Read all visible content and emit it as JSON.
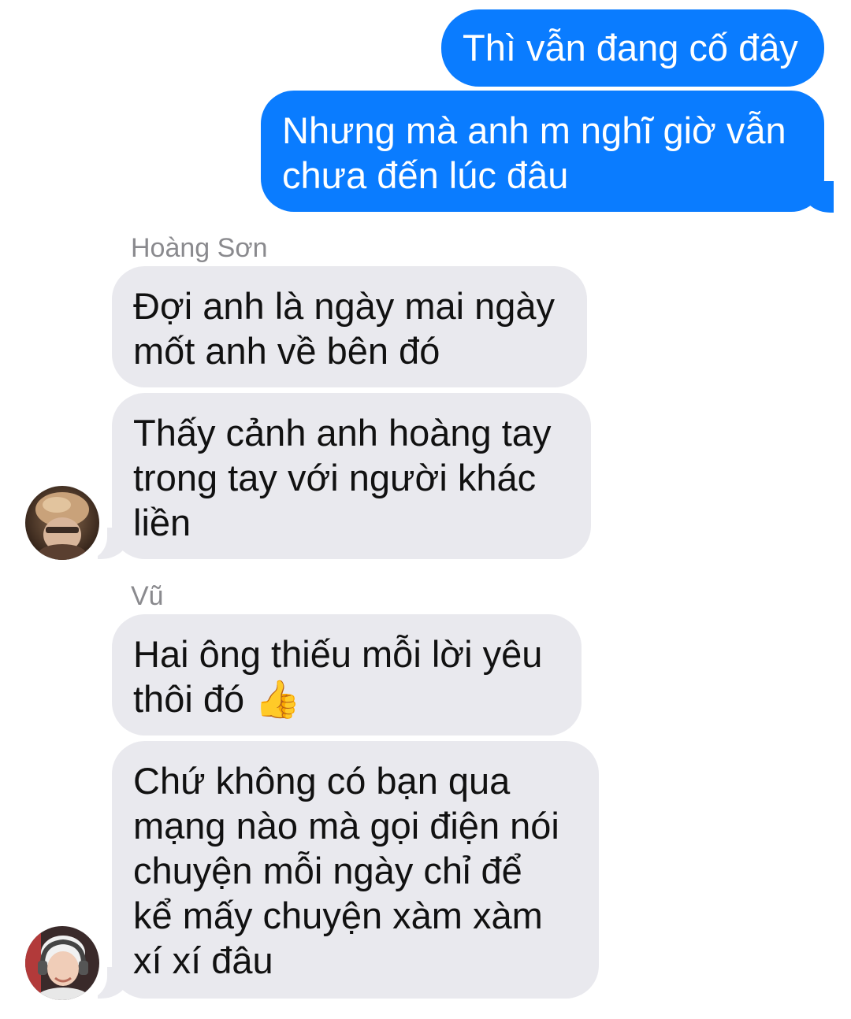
{
  "messages": {
    "outgoing": [
      {
        "lines": [
          "Thì vẫn đang cố đây"
        ]
      },
      {
        "lines": [
          "Nhưng mà anh m nghĩ giờ vẫn",
          "chưa đến lúc đâu"
        ]
      }
    ],
    "groups": [
      {
        "sender": "Hoàng Sơn",
        "avatar_icon": "person-avatar-icon",
        "bubbles": [
          {
            "lines": [
              "Đợi anh là ngày mai ngày",
              "mốt anh về bên đó"
            ]
          },
          {
            "lines": [
              "Thấy cảnh anh hoàng tay",
              "trong tay với người khác",
              "liền"
            ]
          }
        ]
      },
      {
        "sender": "Vũ",
        "avatar_icon": "person-avatar-icon",
        "bubbles": [
          {
            "lines": [
              "Hai ông thiếu mỗi lời yêu",
              "thôi đó"
            ],
            "emoji": "👍"
          },
          {
            "lines": [
              "Chứ không có bạn qua",
              "mạng nào mà gọi điện nói",
              "chuyện mỗi ngày chỉ để",
              "kể mấy chuyện xàm xàm",
              "xí xí đâu"
            ]
          }
        ]
      }
    ]
  },
  "colors": {
    "outgoing_bubble": "#0a7cff",
    "incoming_bubble": "#e9e9ee",
    "sender_name": "#8a8a8e"
  }
}
